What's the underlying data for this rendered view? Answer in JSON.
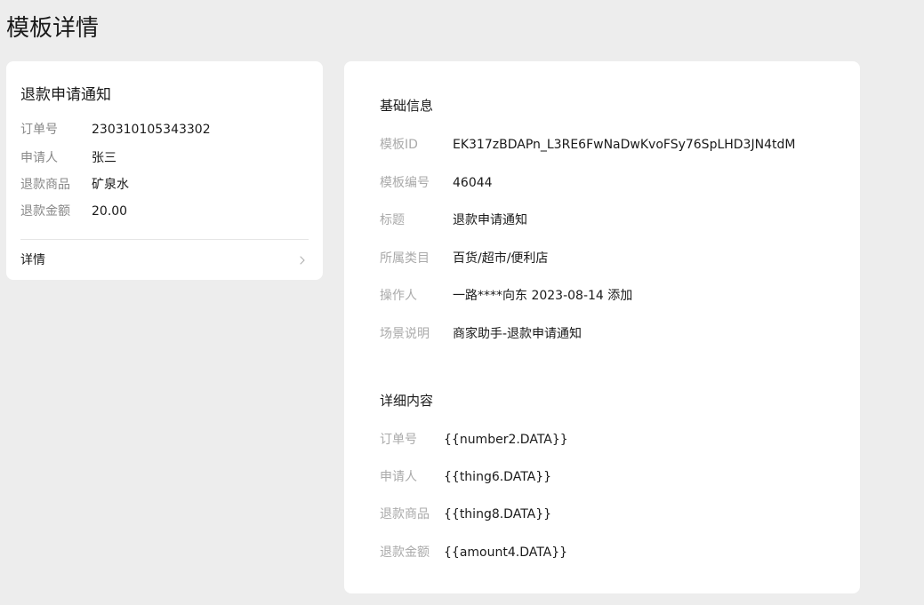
{
  "page": {
    "title": "模板详情"
  },
  "preview": {
    "title": "退款申请通知",
    "rows": [
      {
        "label": "订单号",
        "value": "230310105343302"
      },
      {
        "label": "申请人",
        "value": "张三"
      },
      {
        "label": "退款商品",
        "value": "矿泉水"
      },
      {
        "label": "退款金额",
        "value": "20.00"
      }
    ],
    "detail_link": "详情",
    "detail_icon": "chevron-right-icon"
  },
  "basic_info": {
    "title": "基础信息",
    "rows": [
      {
        "label": "模板ID",
        "value": "EK317zBDAPn_L3RE6FwNaDwKvoFSy76SpLHD3JN4tdM"
      },
      {
        "label": "模板编号",
        "value": "46044"
      },
      {
        "label": "标题",
        "value": "退款申请通知"
      },
      {
        "label": "所属类目",
        "value": "百货/超市/便利店"
      },
      {
        "label": "操作人",
        "value": "一路****向东 2023-08-14 添加"
      },
      {
        "label": "场景说明",
        "value": "商家助手-退款申请通知"
      }
    ]
  },
  "detail_content": {
    "title": "详细内容",
    "rows": [
      {
        "label": "订单号",
        "value": "{{number2.DATA}}"
      },
      {
        "label": "申请人",
        "value": "{{thing6.DATA}}"
      },
      {
        "label": "退款商品",
        "value": "{{thing8.DATA}}"
      },
      {
        "label": "退款金额",
        "value": "{{amount4.DATA}}"
      }
    ]
  },
  "colors": {
    "background": "#ededed",
    "card": "#ffffff",
    "label": "#888888",
    "muted_label": "#aaaaaa",
    "text": "#1a1a1a"
  }
}
